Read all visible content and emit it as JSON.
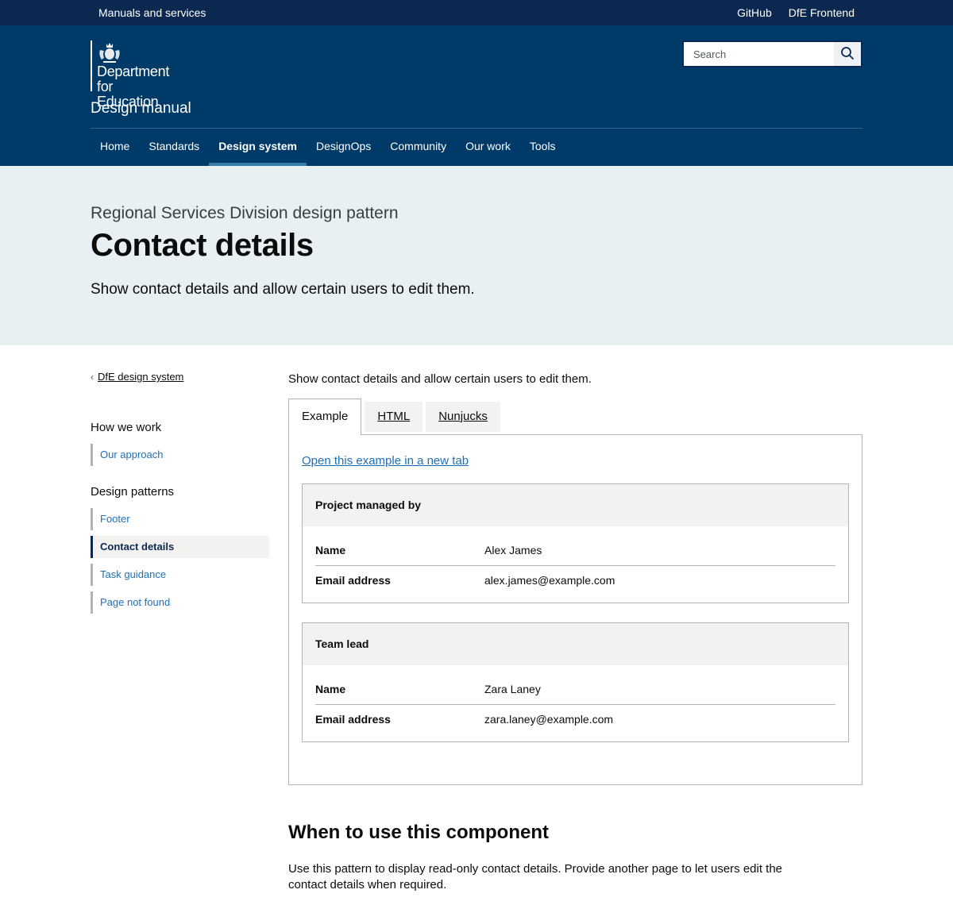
{
  "top_bar": {
    "left_link": "Manuals and services",
    "right_links": [
      "GitHub",
      "DfE Frontend"
    ]
  },
  "header": {
    "logo": {
      "icon": "royal-crest-icon",
      "line1": "Department",
      "line2": "for Education"
    },
    "service_name": "Design manual",
    "search": {
      "placeholder": "Search",
      "value": "",
      "icon": "search-icon"
    },
    "nav": [
      {
        "label": "Home",
        "active": false
      },
      {
        "label": "Standards",
        "active": false
      },
      {
        "label": "Design system",
        "active": true
      },
      {
        "label": "DesignOps",
        "active": false
      },
      {
        "label": "Community",
        "active": false
      },
      {
        "label": "Our work",
        "active": false
      },
      {
        "label": "Tools",
        "active": false
      }
    ]
  },
  "hero": {
    "caption": "Regional Services Division design pattern",
    "title": "Contact details",
    "lead": "Show contact details and allow certain users to edit them."
  },
  "sidebar": {
    "back_link": "DfE design system",
    "sections": [
      {
        "heading": "How we work",
        "items": [
          {
            "label": "Our approach",
            "current": false
          }
        ]
      },
      {
        "heading": "Design patterns",
        "items": [
          {
            "label": "Footer",
            "current": false
          },
          {
            "label": "Contact details",
            "current": true
          },
          {
            "label": "Task guidance",
            "current": false
          },
          {
            "label": "Page not found",
            "current": false
          }
        ]
      }
    ]
  },
  "content": {
    "intro": "Show contact details and allow certain users to edit them.",
    "tabs": [
      {
        "label": "Example",
        "active": true
      },
      {
        "label": "HTML",
        "active": false
      },
      {
        "label": "Nunjucks",
        "active": false
      }
    ],
    "open_example_link": "Open this example in a new tab",
    "cards": [
      {
        "title": "Project managed by",
        "rows": [
          {
            "key": "Name",
            "value": "Alex James"
          },
          {
            "key": "Email address",
            "value": "alex.james@example.com"
          }
        ]
      },
      {
        "title": "Team lead",
        "rows": [
          {
            "key": "Name",
            "value": "Zara Laney"
          },
          {
            "key": "Email address",
            "value": "zara.laney@example.com"
          }
        ]
      }
    ],
    "section_heading": "When to use this component",
    "section_body": "Use this pattern to display read-only contact details. Provide another page to let users edit the contact details when required."
  },
  "colors": {
    "top_bar": "#0b2950",
    "header": "#003a69",
    "nav_active_underline": "#347ca9",
    "hero_bg": "#e8f0f4",
    "link": "#1d70b8",
    "border": "#b1b4b6",
    "card_head_bg": "#f3f2f1"
  }
}
